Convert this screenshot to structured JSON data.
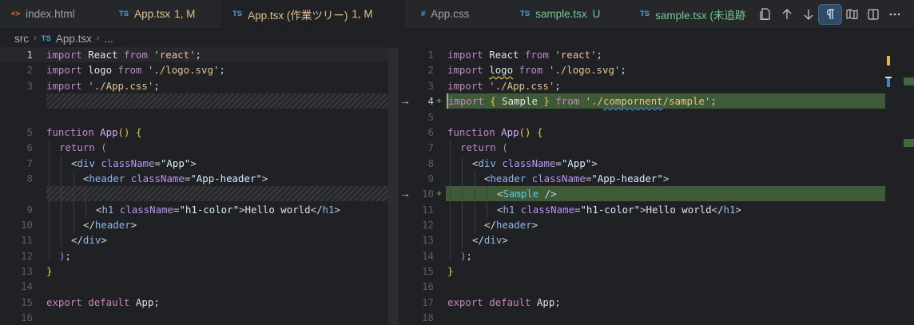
{
  "tabs": [
    {
      "icon": "<>",
      "label": "index.html",
      "state": ""
    },
    {
      "icon": "TS",
      "label": "App.tsx",
      "state": "1, M"
    },
    {
      "icon": "TS",
      "label": "App.tsx (作業ツリー)",
      "state": "1, M"
    },
    {
      "icon": "#",
      "label": "App.css",
      "state": ""
    },
    {
      "icon": "TS",
      "label": "sample.tsx",
      "state": "U"
    },
    {
      "icon": "TS",
      "label": "sample.tsx (未追跡",
      "state": ""
    }
  ],
  "breadcrumb": {
    "folder": "src",
    "file_icon": "TS",
    "file": "App.tsx",
    "more": "..."
  },
  "toolbar": [
    "open-changes-icon",
    "arrow-up-icon",
    "arrow-down-icon",
    "pilcrow-icon",
    "book-icon",
    "split-editor-icon",
    "more-icon"
  ],
  "left_lines": [
    "1",
    "2",
    "3",
    "5",
    "6",
    "7",
    "8",
    "9",
    "10",
    "11",
    "12",
    "13",
    "14",
    "15",
    "16"
  ],
  "right_lines": [
    "1",
    "2",
    "3",
    "4",
    "5",
    "6",
    "7",
    "8",
    "9",
    "10",
    "11",
    "12",
    "13",
    "14",
    "15",
    "16",
    "17",
    "18"
  ],
  "code": {
    "import_kw": "import",
    "from_kw": "from",
    "react": "React",
    "react_path": "'react'",
    "logo": "logo",
    "logo_path": "'./logo.svg'",
    "css_path": "'./App.css'",
    "sample_import_open": "{ ",
    "sample_name": "Sample",
    "sample_import_close": " }",
    "sample_path_pre": "'./",
    "sample_path_mid": "compornent",
    "sample_path_post": "/sample'",
    "semi": ";",
    "function_kw": "function",
    "app_name": "App",
    "parens": "()",
    "open_brace": "{",
    "close_brace": "}",
    "return_kw": "return",
    "open_paren": "(",
    "close_paren": ")",
    "div": "div",
    "header": "header",
    "h1": "h1",
    "classname": "className",
    "app_cls": "\"App\"",
    "header_cls": "\"App-header\"",
    "h1_cls": "\"h1-color\"",
    "hello": "Hello world",
    "sample_tag": "Sample",
    "export_kw": "export",
    "default_kw": "default",
    "app_export": "App"
  }
}
